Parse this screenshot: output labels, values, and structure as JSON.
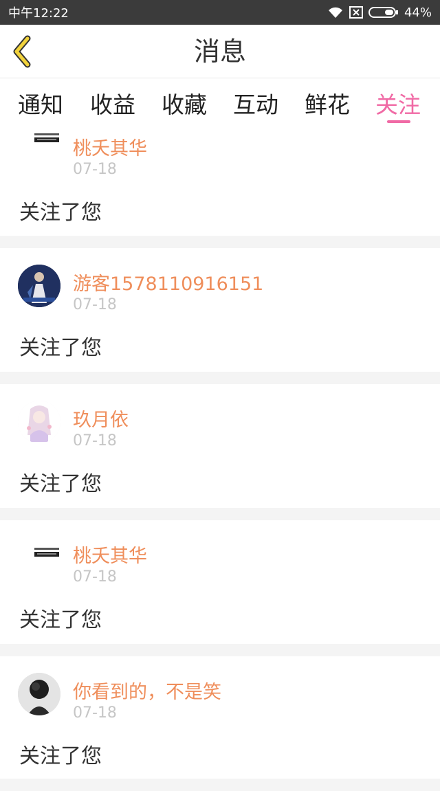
{
  "status_bar": {
    "time": "中午12:22",
    "battery": "44%"
  },
  "header": {
    "title": "消息"
  },
  "tabs": [
    {
      "label": "通知"
    },
    {
      "label": "收益"
    },
    {
      "label": "收藏"
    },
    {
      "label": "互动"
    },
    {
      "label": "鲜花"
    },
    {
      "label": "关注",
      "active": true
    }
  ],
  "colors": {
    "accent": "#f06aa5",
    "username": "#ef8e5b"
  },
  "messages": [
    {
      "username": "桃夭其华",
      "date": "07-18",
      "content": "关注了您",
      "avatar": "banner-avatar"
    },
    {
      "username": "游客1578110916151",
      "date": "07-18",
      "content": "关注了您",
      "avatar": "character-avatar"
    },
    {
      "username": "玖月依",
      "date": "07-18",
      "content": "关注了您",
      "avatar": "anime-girl-avatar"
    },
    {
      "username": "桃夭其华",
      "date": "07-18",
      "content": "关注了您",
      "avatar": "banner-avatar"
    },
    {
      "username": "你看到的，不是笑",
      "date": "07-18",
      "content": "关注了您",
      "avatar": "dark-rose-avatar"
    }
  ]
}
